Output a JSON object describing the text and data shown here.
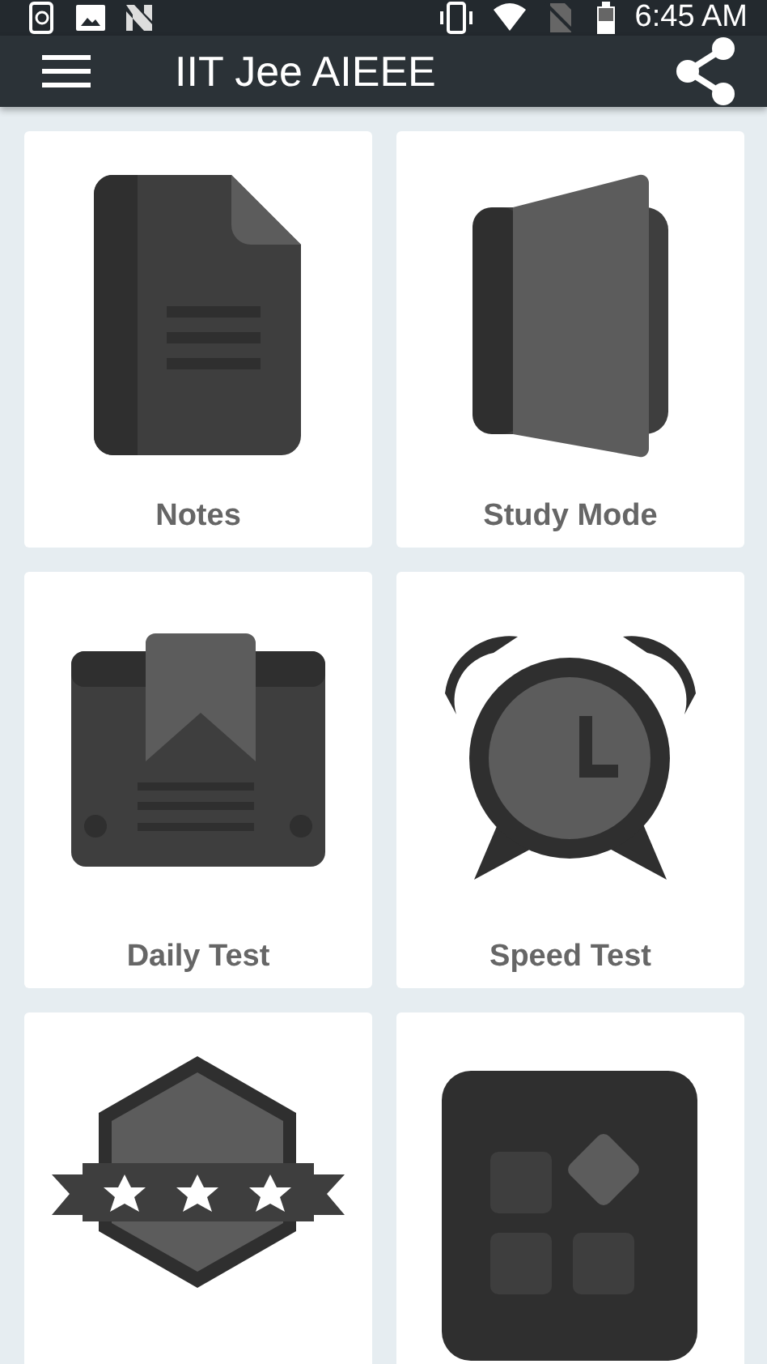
{
  "status_bar": {
    "time": "6:45 AM"
  },
  "app_bar": {
    "title": "IIT Jee AIEEE"
  },
  "tiles": [
    {
      "kind": "notes",
      "label": "Notes"
    },
    {
      "kind": "study",
      "label": "Study Mode"
    },
    {
      "kind": "daily",
      "label": "Daily Test"
    },
    {
      "kind": "speed",
      "label": "Speed Test"
    },
    {
      "kind": "badge"
    },
    {
      "kind": "apps"
    }
  ]
}
